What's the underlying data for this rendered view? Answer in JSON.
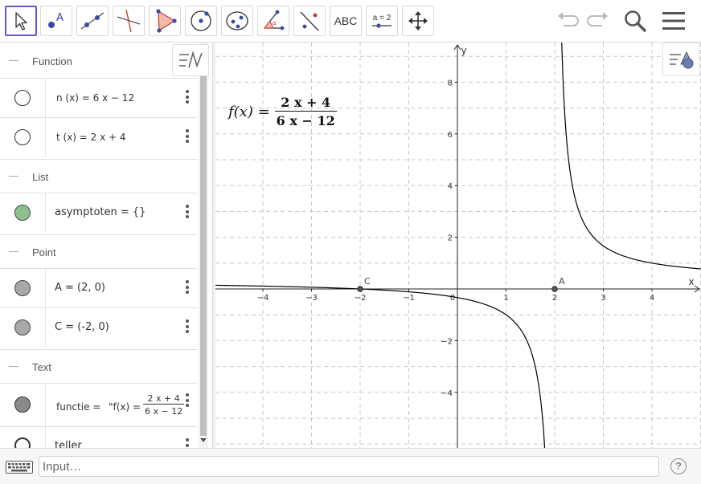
{
  "toolbar": {
    "tools": [
      {
        "name": "move-tool",
        "icon": "arrow-cursor-icon"
      },
      {
        "name": "point-tool",
        "icon": "point-icon",
        "label": "A"
      },
      {
        "name": "line-tool",
        "icon": "line-icon"
      },
      {
        "name": "perpendicular-line-tool",
        "icon": "perpendicular-icon"
      },
      {
        "name": "polygon-tool",
        "icon": "polygon-icon"
      },
      {
        "name": "circle-center-tool",
        "icon": "circle-icon"
      },
      {
        "name": "ellipse-tool",
        "icon": "ellipse-icon"
      },
      {
        "name": "angle-tool",
        "icon": "angle-icon"
      },
      {
        "name": "reflect-tool",
        "icon": "reflect-icon"
      },
      {
        "name": "text-tool",
        "label": "ABC"
      },
      {
        "name": "slider-tool",
        "label": "a = 2"
      },
      {
        "name": "move-graphics-tool",
        "icon": "move-arrows-icon"
      }
    ],
    "right_icons": [
      "undo-icon",
      "redo-icon",
      "search-icon",
      "menu-icon"
    ]
  },
  "algebra": {
    "groups": [
      {
        "title": "Function",
        "items": [
          {
            "text": "n (x)  =  6 x − 12",
            "marker": "#ffffff"
          },
          {
            "text": "t (x)  =  2 x + 4",
            "marker": "#ffffff"
          }
        ]
      },
      {
        "title": "List",
        "items": [
          {
            "text": "asymptoten  =  {}",
            "marker": "#8cbf8c"
          }
        ]
      },
      {
        "title": "Point",
        "items": [
          {
            "text": "A  =  (2, 0)",
            "marker": "#a8a8a8"
          },
          {
            "text": "C  =  (-2, 0)",
            "marker": "#a8a8a8"
          }
        ]
      },
      {
        "title": "Text",
        "items": [
          {
            "text_prefix": "functie  =",
            "quote": "\"f(x)  =",
            "num": "2 x + 4",
            "den": "6 x − 12",
            "marker": "#8a8a8a"
          },
          {
            "text": "teller",
            "marker": "#ffffff"
          }
        ]
      }
    ]
  },
  "graphics": {
    "axis_x_label": "x",
    "axis_y_label": "y",
    "x_ticks": [
      "−4",
      "−3",
      "−2",
      "−1",
      "0",
      "1",
      "2",
      "3",
      "4"
    ],
    "y_ticks": [
      "8",
      "6",
      "4",
      "2",
      "−2",
      "−4"
    ],
    "point_labels": {
      "A": "A",
      "C": "C"
    },
    "formula": {
      "lhs": "f(x) =",
      "num": "2 x + 4",
      "den": "6 x − 12"
    },
    "curve_color": "#000000"
  },
  "inputbar": {
    "placeholder": "Input…",
    "help": "?"
  }
}
